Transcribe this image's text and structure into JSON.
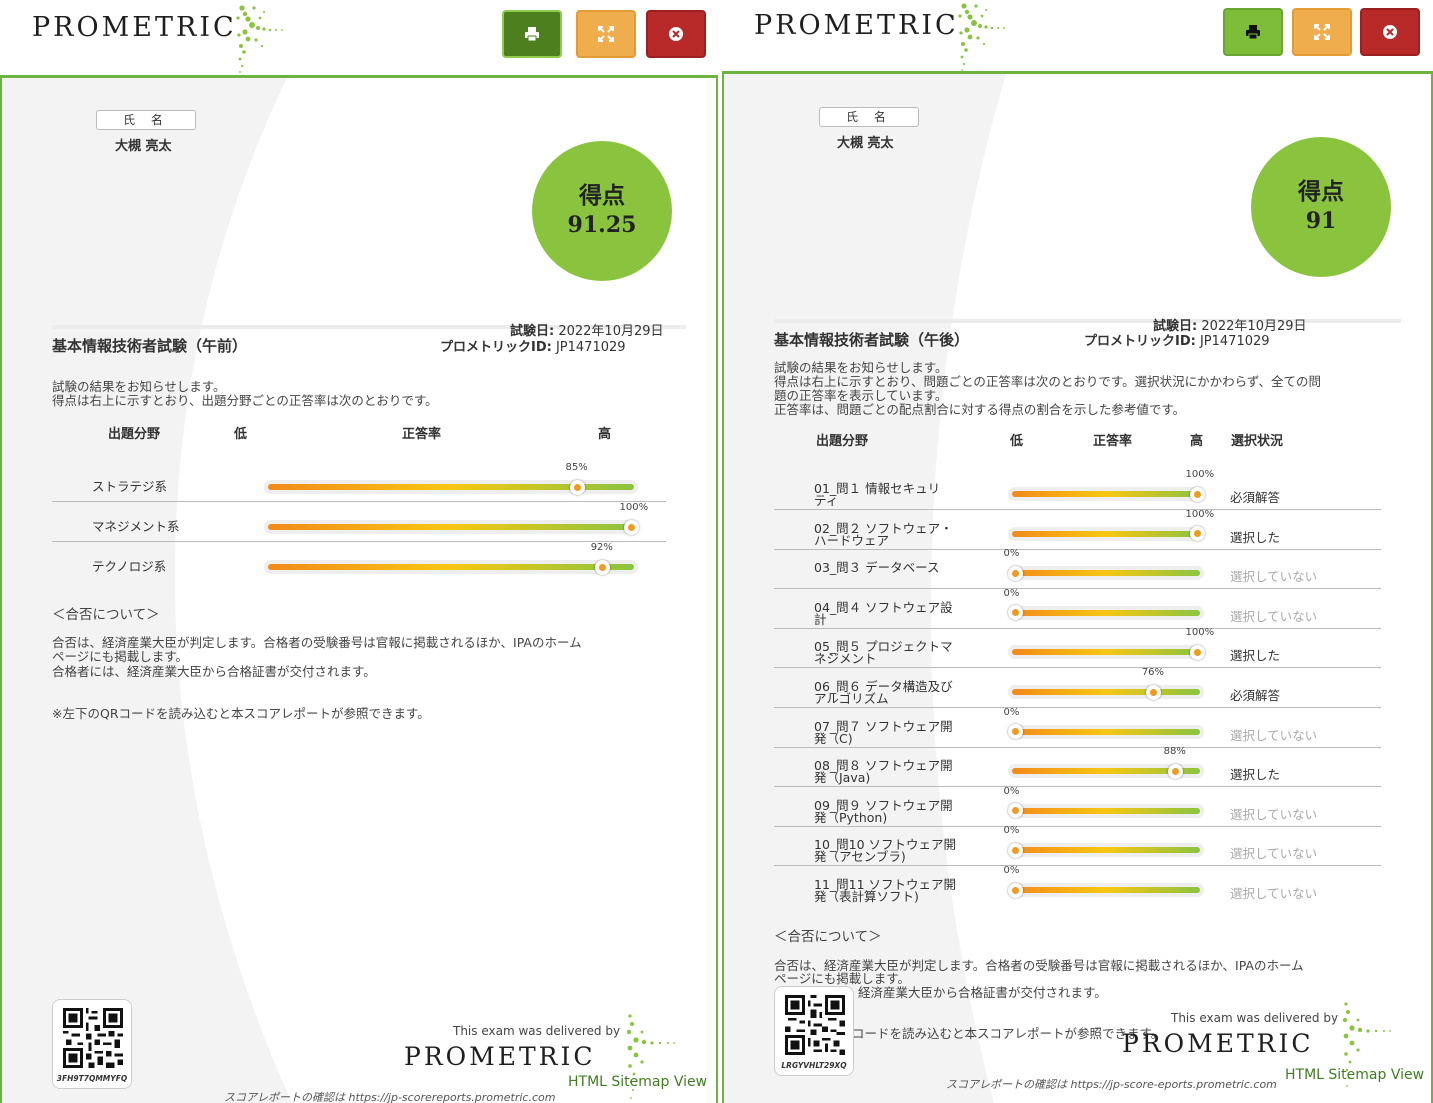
{
  "brand": "PROMETRIC",
  "colors": {
    "accent": "#6db33f",
    "score_circle": "#8ac43f",
    "print": "#7dbd3a",
    "fullscreen": "#f0ad4e",
    "close": "#b82a2a"
  },
  "icons": {
    "print": "print-icon",
    "fullscreen": "expand-icon",
    "close": "close-circle-icon"
  },
  "left": {
    "name_label": "氏 名",
    "name_value": "大槻 亮太",
    "score_label": "得点",
    "score_value": "91.25",
    "exam_date_label": "試験日:",
    "exam_date": "2022年10月29日",
    "exam_title": "基本情報技術者試験（午前）",
    "prometric_id_label": "プロメトリックID:",
    "prometric_id": "JP1471029",
    "intro_1": "試験の結果をお知らせします。",
    "intro_2": "得点は右上に示すとおり、出題分野ごとの正答率は次のとおりです。",
    "col_field": "出題分野",
    "col_low": "低",
    "col_rate": "正答率",
    "col_high": "高",
    "rows": [
      {
        "label": "ストラテジ系",
        "pct_text": "85%",
        "pct": 85
      },
      {
        "label": "マネジメント系",
        "pct_text": "100%",
        "pct": 100
      },
      {
        "label": "テクノロジ系",
        "pct_text": "92%",
        "pct": 92
      }
    ],
    "pass_heading": "＜合否について＞",
    "pass_1": "合否は、経済産業大臣が判定します。合格者の受験番号は官報に掲載されるほか、IPAのホーム",
    "pass_2": "ページにも掲載します。",
    "pass_3": "合格者には、経済産業大臣から合格証書が交付されます。",
    "qr_note": "※左下のQRコードを読み込むと本スコアレポートが参照できます。",
    "qr_code": "3FH9T7QMMYFQ",
    "delivered_by": "This exam was delivered by",
    "sitemap": "HTML Sitemap View",
    "confirm": "スコアレポートの確認は https://jp-scorereports.prometric.com"
  },
  "right": {
    "name_label": "氏 名",
    "name_value": "大槻 亮太",
    "score_label": "得点",
    "score_value": "91",
    "exam_date_label": "試験日:",
    "exam_date": "2022年10月29日",
    "exam_title": "基本情報技術者試験（午後）",
    "prometric_id_label": "プロメトリックID:",
    "prometric_id": "JP1471029",
    "intro_1": "試験の結果をお知らせします。",
    "intro_2": "得点は右上に示すとおり、問題ごとの正答率は次のとおりです。選択状況にかかわらず、全ての問",
    "intro_3": "題の正答率を表示しています。",
    "intro_4": "正答率は、問題ごとの配点割合に対する得点の割合を示した参考値です。",
    "col_field": "出題分野",
    "col_low": "低",
    "col_rate": "正答率",
    "col_high": "高",
    "col_status": "選択状況",
    "rows": [
      {
        "label_1": "01_問１ 情報セキュリ",
        "label_2": "ティ",
        "pct_text": "100%",
        "pct": 100,
        "status": "必須解答",
        "muted": false
      },
      {
        "label_1": "02_問２ ソフトウェア・",
        "label_2": "ハードウェア",
        "pct_text": "100%",
        "pct": 100,
        "status": "選択した",
        "muted": false
      },
      {
        "label_1": "03_問３ データベース",
        "label_2": "",
        "pct_text": "0%",
        "pct": 0,
        "status": "選択していない",
        "muted": true
      },
      {
        "label_1": "04_問４ ソフトウェア設",
        "label_2": "計",
        "pct_text": "0%",
        "pct": 0,
        "status": "選択していない",
        "muted": true
      },
      {
        "label_1": "05_問５ プロジェクトマ",
        "label_2": "ネジメント",
        "pct_text": "100%",
        "pct": 100,
        "status": "選択した",
        "muted": false
      },
      {
        "label_1": "06_問６ データ構造及び",
        "label_2": "アルゴリズム",
        "pct_text": "76%",
        "pct": 76,
        "status": "必須解答",
        "muted": false
      },
      {
        "label_1": "07_問７ ソフトウェア開",
        "label_2": "発（C)",
        "pct_text": "0%",
        "pct": 0,
        "status": "選択していない",
        "muted": true
      },
      {
        "label_1": "08_問８ ソフトウェア開",
        "label_2": "発（Java)",
        "pct_text": "88%",
        "pct": 88,
        "status": "選択した",
        "muted": false
      },
      {
        "label_1": "09_問９ ソフトウェア開",
        "label_2": "発（Python)",
        "pct_text": "0%",
        "pct": 0,
        "status": "選択していない",
        "muted": true
      },
      {
        "label_1": "10_問10 ソフトウェア開",
        "label_2": "発（アセンブラ)",
        "pct_text": "0%",
        "pct": 0,
        "status": "選択していない",
        "muted": true
      },
      {
        "label_1": "11_問11 ソフトウェア開",
        "label_2": "発（表計算ソフト)",
        "pct_text": "0%",
        "pct": 0,
        "status": "選択していない",
        "muted": true
      }
    ],
    "pass_heading": "＜合否について＞",
    "pass_1": "合否は、経済産業大臣が判定します。合格者の受験番号は官報に掲載されるほか、IPAのホーム",
    "pass_2": "ページにも掲載します。",
    "pass_3": "経済産業大臣から合格証書が交付されます。",
    "qr_note": "コードを読み込むと本スコアレポートが参照できます。",
    "qr_code": "LRGYVHLT29XQ",
    "delivered_by": "This exam was delivered by",
    "sitemap": "HTML Sitemap View",
    "confirm": "スコアレポートの確認は https://jp-score-eports.prometric.com"
  }
}
